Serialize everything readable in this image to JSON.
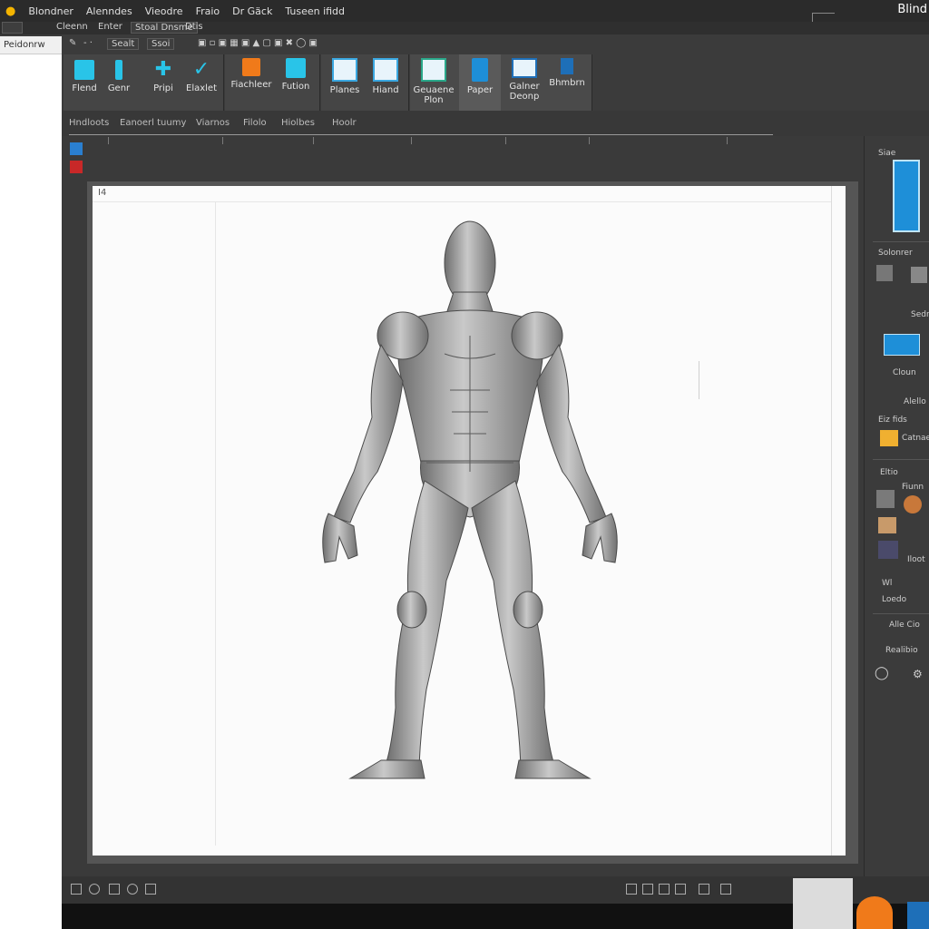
{
  "titlebar": {
    "menu": [
      "Blondner",
      "Alenndes",
      "Vieodre",
      "Fraio",
      "Dr Gäck",
      "Tuseen ifidd"
    ],
    "app_title": "Blind"
  },
  "row2": {
    "items": [
      "Cleenn",
      "Enter",
      "Sealt",
      "Ssoi",
      "Stoal Dnsme",
      "Dtis"
    ]
  },
  "leftstrip": {
    "label": "Peidonrw"
  },
  "ribbon": {
    "buttons": [
      "Flend",
      "Genr",
      "Pripi",
      "Elaxlet",
      "Fiachleer",
      "Fution",
      "Planes",
      "Hiand"
    ],
    "group2": [
      "Geuaene",
      "Plon",
      "Paper",
      "Galner",
      "Bhmbrn",
      "Deonp"
    ]
  },
  "crumbs": [
    "Hndloots",
    "Eanoerl tuumy",
    "Viarnos",
    "Filolo",
    "Hiolbes",
    "Hoolr"
  ],
  "canvas": {
    "label": "I4"
  },
  "rightpanel": {
    "labels": [
      "Siae",
      "Solonrer",
      "Sedr",
      "Cloun",
      "Alello",
      "Eiz fids",
      "Catnae",
      "Eltio",
      "Fiunn",
      "Iloot",
      "Wl",
      "Loedo",
      "Alle Cio",
      "Realibio"
    ]
  },
  "colors": {
    "accent_cyan": "#29c4e8",
    "accent_orange": "#f07a1a",
    "accent_blue": "#1e8fd8"
  }
}
